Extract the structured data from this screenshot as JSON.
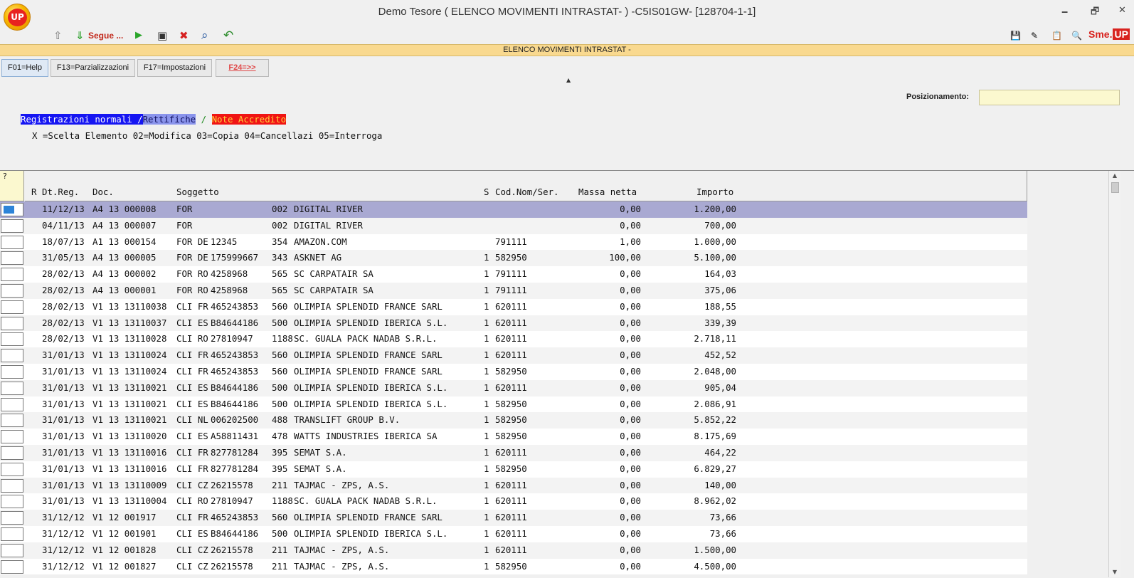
{
  "window": {
    "title": "Demo Tesore ( ELENCO MOVIMENTI INTRASTAT- ) -C5IS01GW- [128704-1-1]",
    "logo_text": "UP",
    "brand_text": "Sme.",
    "brand_badge": "UP",
    "minimize_glyph": "🗕",
    "restore_glyph": "🗗",
    "close_glyph": "✕"
  },
  "toolbar": {
    "up_glyph": "⇧",
    "down_glyph": "⇓",
    "segue_label": "Segue ...",
    "play_glyph": "▶",
    "screen_glyph": "▣",
    "cancel_glyph": "✖",
    "search_glyph": "⌕",
    "back_glyph": "↶",
    "right_icons": [
      "💾",
      "✎",
      "📋",
      "🔍"
    ]
  },
  "banner": {
    "text": "ELENCO MOVIMENTI INTRASTAT -"
  },
  "fkeys": [
    {
      "label": "F01=Help"
    },
    {
      "label": "F13=Parzializzazioni"
    },
    {
      "label": "F17=Impostazioni"
    },
    {
      "label": "F24=>>"
    }
  ],
  "positioning": {
    "label": "Posizionamento:",
    "value": ""
  },
  "legend": {
    "normal": "Registrazioni normali /",
    "rettifiche": "Rettifiche",
    "separator": "/",
    "note": "Note Accredito"
  },
  "options_line": "X =Scelta Elemento 02=Modifica 03=Copia 04=Cancellazi 05=Interroga",
  "table": {
    "select_header": "?",
    "headers": {
      "r": "R",
      "dtreg": "Dt.Reg.",
      "doc": "Doc.",
      "soggetto": "Soggetto",
      "s": "S",
      "codnom": "Cod.Nom/Ser.",
      "massa": "Massa netta",
      "importo": "Importo"
    },
    "rows": [
      {
        "dt": "11/12/13",
        "doc": "A4 13 000008",
        "sogg": "FOR",
        "piva": "",
        "code": "002",
        "name": "DIGITAL RIVER",
        "s": "",
        "cod": "",
        "massa": "0,00",
        "importo": "1.200,00"
      },
      {
        "dt": "04/11/13",
        "doc": "A4 13 000007",
        "sogg": "FOR",
        "piva": "",
        "code": "002",
        "name": "DIGITAL RIVER",
        "s": "",
        "cod": "",
        "massa": "0,00",
        "importo": "700,00"
      },
      {
        "dt": "18/07/13",
        "doc": "A1 13 000154",
        "sogg": "FOR DE",
        "piva": "12345",
        "code": "354",
        "name": "AMAZON.COM",
        "s": "",
        "cod": "791111",
        "massa": "1,00",
        "importo": "1.000,00"
      },
      {
        "dt": "31/05/13",
        "doc": "A4 13 000005",
        "sogg": "FOR DE",
        "piva": "175999667",
        "code": "343",
        "name": "ASKNET AG",
        "s": "1",
        "cod": "582950",
        "massa": "100,00",
        "importo": "5.100,00"
      },
      {
        "dt": "28/02/13",
        "doc": "A4 13 000002",
        "sogg": "FOR RO",
        "piva": "4258968",
        "code": "565",
        "name": "SC CARPATAIR SA",
        "s": "1",
        "cod": "791111",
        "massa": "0,00",
        "importo": "164,03"
      },
      {
        "dt": "28/02/13",
        "doc": "A4 13 000001",
        "sogg": "FOR RO",
        "piva": "4258968",
        "code": "565",
        "name": "SC CARPATAIR SA",
        "s": "1",
        "cod": "791111",
        "massa": "0,00",
        "importo": "375,06"
      },
      {
        "dt": "28/02/13",
        "doc": "V1 13 13110038",
        "sogg": "CLI FR",
        "piva": "465243853",
        "code": "560",
        "name": "OLIMPIA SPLENDID FRANCE SARL",
        "s": "1",
        "cod": "620111",
        "massa": "0,00",
        "importo": "188,55"
      },
      {
        "dt": "28/02/13",
        "doc": "V1 13 13110037",
        "sogg": "CLI ES",
        "piva": "B84644186",
        "code": "500",
        "name": "OLIMPIA SPLENDID IBERICA S.L.",
        "s": "1",
        "cod": "620111",
        "massa": "0,00",
        "importo": "339,39"
      },
      {
        "dt": "28/02/13",
        "doc": "V1 13 13110028",
        "sogg": "CLI RO",
        "piva": "27810947",
        "code": "1188",
        "name": "SC. GUALA PACK NADAB S.R.L.",
        "s": "1",
        "cod": "620111",
        "massa": "0,00",
        "importo": "2.718,11"
      },
      {
        "dt": "31/01/13",
        "doc": "V1 13 13110024",
        "sogg": "CLI FR",
        "piva": "465243853",
        "code": "560",
        "name": "OLIMPIA SPLENDID FRANCE SARL",
        "s": "1",
        "cod": "620111",
        "massa": "0,00",
        "importo": "452,52"
      },
      {
        "dt": "31/01/13",
        "doc": "V1 13 13110024",
        "sogg": "CLI FR",
        "piva": "465243853",
        "code": "560",
        "name": "OLIMPIA SPLENDID FRANCE SARL",
        "s": "1",
        "cod": "582950",
        "massa": "0,00",
        "importo": "2.048,00"
      },
      {
        "dt": "31/01/13",
        "doc": "V1 13 13110021",
        "sogg": "CLI ES",
        "piva": "B84644186",
        "code": "500",
        "name": "OLIMPIA SPLENDID IBERICA S.L.",
        "s": "1",
        "cod": "620111",
        "massa": "0,00",
        "importo": "905,04"
      },
      {
        "dt": "31/01/13",
        "doc": "V1 13 13110021",
        "sogg": "CLI ES",
        "piva": "B84644186",
        "code": "500",
        "name": "OLIMPIA SPLENDID IBERICA S.L.",
        "s": "1",
        "cod": "582950",
        "massa": "0,00",
        "importo": "2.086,91"
      },
      {
        "dt": "31/01/13",
        "doc": "V1 13 13110021",
        "sogg": "CLI NL",
        "piva": "006202500",
        "code": "488",
        "name": "TRANSLIFT GROUP B.V.",
        "s": "1",
        "cod": "582950",
        "massa": "0,00",
        "importo": "5.852,22"
      },
      {
        "dt": "31/01/13",
        "doc": "V1 13 13110020",
        "sogg": "CLI ES",
        "piva": "A58811431",
        "code": "478",
        "name": "WATTS INDUSTRIES IBERICA SA",
        "s": "1",
        "cod": "582950",
        "massa": "0,00",
        "importo": "8.175,69"
      },
      {
        "dt": "31/01/13",
        "doc": "V1 13 13110016",
        "sogg": "CLI FR",
        "piva": "827781284",
        "code": "395",
        "name": "SEMAT S.A.",
        "s": "1",
        "cod": "620111",
        "massa": "0,00",
        "importo": "464,22"
      },
      {
        "dt": "31/01/13",
        "doc": "V1 13 13110016",
        "sogg": "CLI FR",
        "piva": "827781284",
        "code": "395",
        "name": "SEMAT S.A.",
        "s": "1",
        "cod": "582950",
        "massa": "0,00",
        "importo": "6.829,27"
      },
      {
        "dt": "31/01/13",
        "doc": "V1 13 13110009",
        "sogg": "CLI CZ",
        "piva": "26215578",
        "code": "211",
        "name": "TAJMAC - ZPS, A.S.",
        "s": "1",
        "cod": "620111",
        "massa": "0,00",
        "importo": "140,00"
      },
      {
        "dt": "31/01/13",
        "doc": "V1 13 13110004",
        "sogg": "CLI RO",
        "piva": "27810947",
        "code": "1188",
        "name": "SC. GUALA PACK NADAB S.R.L.",
        "s": "1",
        "cod": "620111",
        "massa": "0,00",
        "importo": "8.962,02"
      },
      {
        "dt": "31/12/12",
        "doc": "V1 12 001917",
        "sogg": "CLI FR",
        "piva": "465243853",
        "code": "560",
        "name": "OLIMPIA SPLENDID FRANCE SARL",
        "s": "1",
        "cod": "620111",
        "massa": "0,00",
        "importo": "73,66"
      },
      {
        "dt": "31/12/12",
        "doc": "V1 12 001901",
        "sogg": "CLI ES",
        "piva": "B84644186",
        "code": "500",
        "name": "OLIMPIA SPLENDID IBERICA S.L.",
        "s": "1",
        "cod": "620111",
        "massa": "0,00",
        "importo": "73,66"
      },
      {
        "dt": "31/12/12",
        "doc": "V1 12 001828",
        "sogg": "CLI CZ",
        "piva": "26215578",
        "code": "211",
        "name": "TAJMAC - ZPS, A.S.",
        "s": "1",
        "cod": "620111",
        "massa": "0,00",
        "importo": "1.500,00"
      },
      {
        "dt": "31/12/12",
        "doc": "V1 12 001827",
        "sogg": "CLI CZ",
        "piva": "26215578",
        "code": "211",
        "name": "TAJMAC - ZPS, A.S.",
        "s": "1",
        "cod": "582950",
        "massa": "0,00",
        "importo": "4.500,00"
      }
    ]
  }
}
